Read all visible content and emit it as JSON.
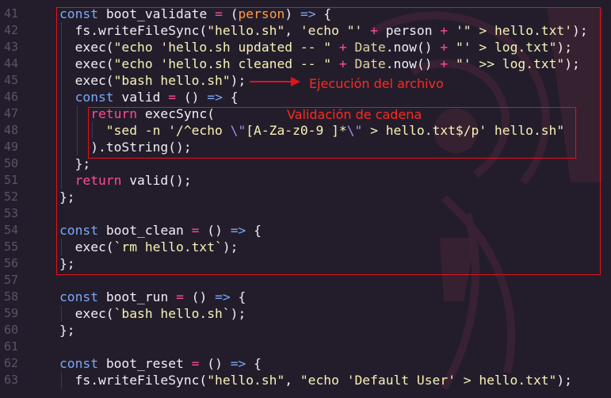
{
  "colors": {
    "background": "#231d2b",
    "line_number": "#5a536a",
    "keyword": "#7aa9f5",
    "return_keyword": "#ff4d8f",
    "string": "#f7f2b6",
    "operator": "#ff4d8f",
    "parameter": "#ff9b45",
    "class_name": "#e2d3a4",
    "escape": "#a58ef0",
    "plain": "#f1eef5",
    "annotation": "#e8101a"
  },
  "editor": {
    "lines": [
      {
        "number": "41",
        "indent": 0,
        "tokens": [
          {
            "t": "keyword",
            "v": "const"
          },
          {
            "t": "plain",
            "v": " "
          },
          {
            "t": "fn",
            "v": "boot_validate"
          },
          {
            "t": "plain",
            "v": " "
          },
          {
            "t": "operator",
            "v": "="
          },
          {
            "t": "plain",
            "v": " ("
          },
          {
            "t": "param",
            "v": "person"
          },
          {
            "t": "plain",
            "v": ") "
          },
          {
            "t": "keyword",
            "v": "=>"
          },
          {
            "t": "plain",
            "v": " {"
          }
        ]
      },
      {
        "number": "42",
        "indent": 1,
        "tokens": [
          {
            "t": "plain",
            "v": "fs.writeFileSync("
          },
          {
            "t": "string",
            "v": "\"hello.sh\""
          },
          {
            "t": "plain",
            "v": ", "
          },
          {
            "t": "string",
            "v": "'echo \"'"
          },
          {
            "t": "plain",
            "v": " "
          },
          {
            "t": "operator",
            "v": "+"
          },
          {
            "t": "plain",
            "v": " person "
          },
          {
            "t": "operator",
            "v": "+"
          },
          {
            "t": "plain",
            "v": " "
          },
          {
            "t": "string",
            "v": "'\" > hello.txt'"
          },
          {
            "t": "plain",
            "v": ");"
          }
        ]
      },
      {
        "number": "43",
        "indent": 1,
        "tokens": [
          {
            "t": "plain",
            "v": "exec("
          },
          {
            "t": "string",
            "v": "\"echo 'hello.sh updated -- \""
          },
          {
            "t": "plain",
            "v": " "
          },
          {
            "t": "operator",
            "v": "+"
          },
          {
            "t": "plain",
            "v": " "
          },
          {
            "t": "class",
            "v": "Date"
          },
          {
            "t": "plain",
            "v": ".now() "
          },
          {
            "t": "operator",
            "v": "+"
          },
          {
            "t": "plain",
            "v": " "
          },
          {
            "t": "string",
            "v": "\"' > log.txt\""
          },
          {
            "t": "plain",
            "v": ");"
          }
        ]
      },
      {
        "number": "44",
        "indent": 1,
        "tokens": [
          {
            "t": "plain",
            "v": "exec("
          },
          {
            "t": "string",
            "v": "\"echo 'hello.sh cleaned -- \""
          },
          {
            "t": "plain",
            "v": " "
          },
          {
            "t": "operator",
            "v": "+"
          },
          {
            "t": "plain",
            "v": " "
          },
          {
            "t": "class",
            "v": "Date"
          },
          {
            "t": "plain",
            "v": ".now() "
          },
          {
            "t": "operator",
            "v": "+"
          },
          {
            "t": "plain",
            "v": " "
          },
          {
            "t": "string",
            "v": "\"' >> log.txt\""
          },
          {
            "t": "plain",
            "v": ");"
          }
        ]
      },
      {
        "number": "45",
        "indent": 1,
        "tokens": [
          {
            "t": "plain",
            "v": "exec("
          },
          {
            "t": "string",
            "v": "\"bash hello.sh\""
          },
          {
            "t": "plain",
            "v": ");"
          }
        ]
      },
      {
        "number": "46",
        "indent": 1,
        "tokens": [
          {
            "t": "keyword",
            "v": "const"
          },
          {
            "t": "plain",
            "v": " "
          },
          {
            "t": "fn",
            "v": "valid"
          },
          {
            "t": "plain",
            "v": " "
          },
          {
            "t": "operator",
            "v": "="
          },
          {
            "t": "plain",
            "v": " () "
          },
          {
            "t": "keyword",
            "v": "=>"
          },
          {
            "t": "plain",
            "v": " {"
          }
        ]
      },
      {
        "number": "47",
        "indent": 2,
        "tokens": [
          {
            "t": "return",
            "v": "return"
          },
          {
            "t": "plain",
            "v": " execSync("
          }
        ]
      },
      {
        "number": "48",
        "indent": 3,
        "tokens": [
          {
            "t": "string",
            "v": "\"sed -n '/^echo "
          },
          {
            "t": "escape",
            "v": "\\\""
          },
          {
            "t": "string",
            "v": "[A-Za-z0-9 ]*"
          },
          {
            "t": "escape",
            "v": "\\\""
          },
          {
            "t": "string",
            "v": " > hello.txt$/p' hello.sh\""
          }
        ]
      },
      {
        "number": "49",
        "indent": 2,
        "tokens": [
          {
            "t": "plain",
            "v": ").toString();"
          }
        ]
      },
      {
        "number": "50",
        "indent": 1,
        "tokens": [
          {
            "t": "plain",
            "v": "};"
          }
        ]
      },
      {
        "number": "51",
        "indent": 1,
        "tokens": [
          {
            "t": "return",
            "v": "return"
          },
          {
            "t": "plain",
            "v": " valid();"
          }
        ]
      },
      {
        "number": "52",
        "indent": 0,
        "tokens": [
          {
            "t": "plain",
            "v": "};"
          }
        ]
      },
      {
        "number": "53",
        "indent": 0,
        "tokens": []
      },
      {
        "number": "54",
        "indent": 0,
        "tokens": [
          {
            "t": "keyword",
            "v": "const"
          },
          {
            "t": "plain",
            "v": " "
          },
          {
            "t": "fn",
            "v": "boot_clean"
          },
          {
            "t": "plain",
            "v": " "
          },
          {
            "t": "operator",
            "v": "="
          },
          {
            "t": "plain",
            "v": " () "
          },
          {
            "t": "keyword",
            "v": "=>"
          },
          {
            "t": "plain",
            "v": " {"
          }
        ]
      },
      {
        "number": "55",
        "indent": 1,
        "tokens": [
          {
            "t": "plain",
            "v": "exec("
          },
          {
            "t": "string",
            "v": "`rm hello.txt`"
          },
          {
            "t": "plain",
            "v": ");"
          }
        ]
      },
      {
        "number": "56",
        "indent": 0,
        "tokens": [
          {
            "t": "plain",
            "v": "};"
          }
        ]
      },
      {
        "number": "57",
        "indent": 0,
        "tokens": []
      },
      {
        "number": "58",
        "indent": 0,
        "tokens": [
          {
            "t": "keyword",
            "v": "const"
          },
          {
            "t": "plain",
            "v": " "
          },
          {
            "t": "fn",
            "v": "boot_run"
          },
          {
            "t": "plain",
            "v": " "
          },
          {
            "t": "operator",
            "v": "="
          },
          {
            "t": "plain",
            "v": " () "
          },
          {
            "t": "keyword",
            "v": "=>"
          },
          {
            "t": "plain",
            "v": " {"
          }
        ]
      },
      {
        "number": "59",
        "indent": 1,
        "tokens": [
          {
            "t": "plain",
            "v": "exec("
          },
          {
            "t": "string",
            "v": "`bash hello.sh`"
          },
          {
            "t": "plain",
            "v": ");"
          }
        ]
      },
      {
        "number": "60",
        "indent": 0,
        "tokens": [
          {
            "t": "plain",
            "v": "};"
          }
        ]
      },
      {
        "number": "61",
        "indent": 0,
        "tokens": []
      },
      {
        "number": "62",
        "indent": 0,
        "tokens": [
          {
            "t": "keyword",
            "v": "const"
          },
          {
            "t": "plain",
            "v": " "
          },
          {
            "t": "fn",
            "v": "boot_reset"
          },
          {
            "t": "plain",
            "v": " "
          },
          {
            "t": "operator",
            "v": "="
          },
          {
            "t": "plain",
            "v": " () "
          },
          {
            "t": "keyword",
            "v": "=>"
          },
          {
            "t": "plain",
            "v": " {"
          }
        ]
      },
      {
        "number": "63",
        "indent": 1,
        "tokens": [
          {
            "t": "plain",
            "v": "fs.writeFileSync("
          },
          {
            "t": "string",
            "v": "\"hello.sh\""
          },
          {
            "t": "plain",
            "v": ", "
          },
          {
            "t": "string",
            "v": "\"echo 'Default User' > hello.txt\""
          },
          {
            "t": "plain",
            "v": ");"
          }
        ]
      }
    ]
  },
  "annotations": {
    "file_execution_label": "Ejecución del archivo",
    "string_validation_label": "Validación de cadena"
  }
}
